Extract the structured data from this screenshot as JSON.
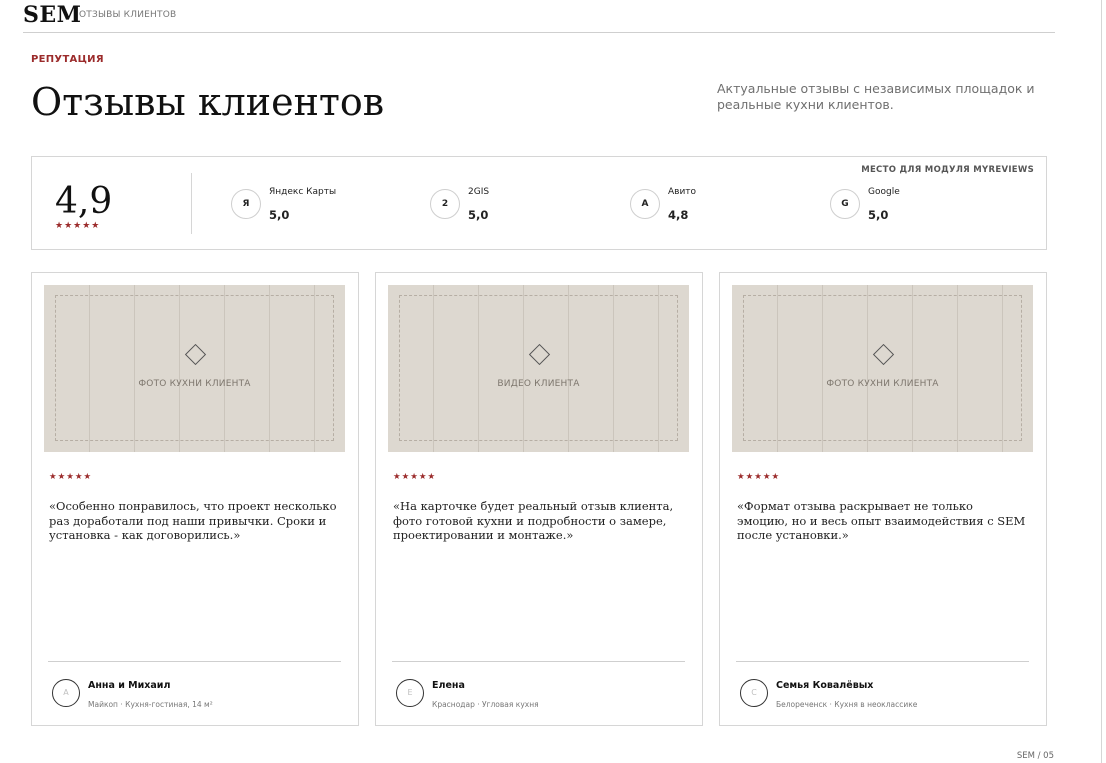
{
  "header": {
    "logo": "SEM",
    "subtitle": "ОТЗЫВЫ КЛИЕНТОВ"
  },
  "section": {
    "eyebrow": "РЕПУТАЦИЯ",
    "title": "Отзывы клиентов",
    "intro": "Актуальные отзывы с независимых площадок и реальные кухни клиентов."
  },
  "rating_panel": {
    "module_label": "МЕСТО ДЛЯ МОДУЛЯ MYREVIEWS",
    "overall_score": "4,9",
    "overall_stars": "★★★★★",
    "platforms": [
      {
        "badge": "Я",
        "name": "Яндекс Карты",
        "score": "5,0"
      },
      {
        "badge": "2",
        "name": "2GIS",
        "score": "5,0"
      },
      {
        "badge": "A",
        "name": "Авито",
        "score": "4,8"
      },
      {
        "badge": "G",
        "name": "Google",
        "score": "5,0"
      }
    ]
  },
  "reviews": [
    {
      "media_label": "ФОТО КУХНИ КЛИЕНТА",
      "stars": "★★★★★",
      "quote": "«Особенно понравилось, что проект несколько раз доработали под наши привычки. Сроки и установка - как договорились.»",
      "avatar": "А",
      "author": "Анна и Михаил",
      "meta": "Майкоп · Кухня-гостиная, 14 м²"
    },
    {
      "media_label": "ВИДЕО КЛИЕНТА",
      "stars": "★★★★★",
      "quote": "«На карточке будет реальный отзыв клиента, фото готовой кухни и подробности о замере, проектировании и монтаже.»",
      "avatar": "Е",
      "author": "Елена",
      "meta": "Краснодар · Угловая кухня"
    },
    {
      "media_label": "ФОТО КУХНИ КЛИЕНТА",
      "stars": "★★★★★",
      "quote": "«Формат отзыва раскрывает не только эмоцию, но и весь опыт взаимодействия с SEM после установки.»",
      "avatar": "С",
      "author": "Семья Ковалёвых",
      "meta": "Белореченск · Кухня в неоклассике"
    }
  ],
  "footer": {
    "page": "SEM / 05"
  },
  "colors": {
    "accent": "#9b2b2b",
    "media_bg": "#ddd8d0",
    "border": "#d6d6d6"
  }
}
